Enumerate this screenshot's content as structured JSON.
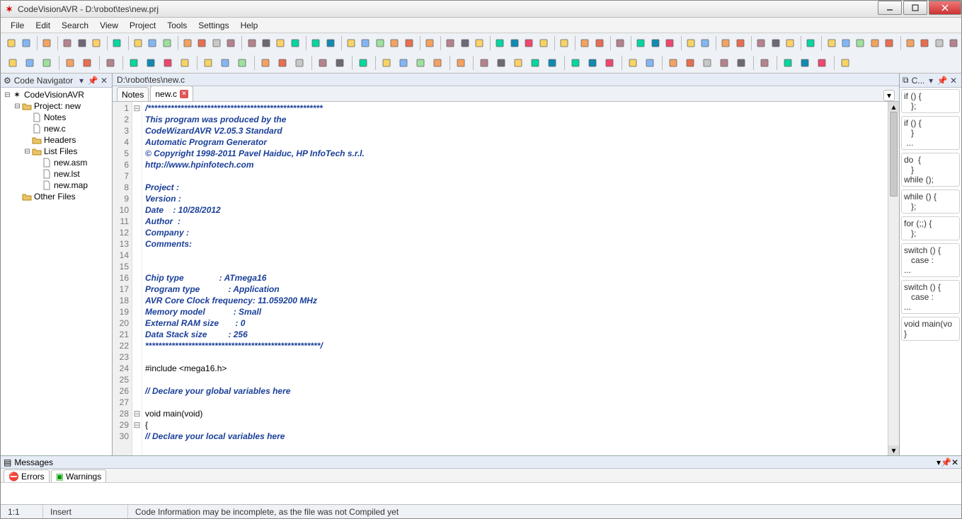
{
  "title": "CodeVisionAVR - D:\\robot\\tes\\new.prj",
  "menu": [
    "File",
    "Edit",
    "Search",
    "View",
    "Project",
    "Tools",
    "Settings",
    "Help"
  ],
  "nav": {
    "title": "Code Navigator",
    "root": "CodeVisionAVR",
    "project": "Project: new",
    "items": [
      "Notes",
      "new.c",
      "Headers"
    ],
    "listfiles": "List Files",
    "listitems": [
      "new.asm",
      "new.lst",
      "new.map"
    ],
    "other": "Other Files"
  },
  "editor": {
    "path": "D:\\robot\\tes\\new.c",
    "tabs": [
      {
        "label": "Notes",
        "active": false
      },
      {
        "label": "new.c",
        "active": true
      }
    ],
    "lines": [
      "/*****************************************************",
      "This program was produced by the",
      "CodeWizardAVR V2.05.3 Standard",
      "Automatic Program Generator",
      "© Copyright 1998-2011 Pavel Haiduc, HP InfoTech s.r.l.",
      "http://www.hpinfotech.com",
      "",
      "Project :",
      "Version :",
      "Date    : 10/28/2012",
      "Author  :",
      "Company :",
      "Comments:",
      "",
      "",
      "Chip type               : ATmega16",
      "Program type            : Application",
      "AVR Core Clock frequency: 11.059200 MHz",
      "Memory model            : Small",
      "External RAM size       : 0",
      "Data Stack size         : 256",
      "*****************************************************/",
      "",
      "#include <mega16.h>",
      "",
      "// Declare your global variables here",
      "",
      "void main(void)",
      "{",
      "// Declare your local variables here"
    ],
    "plain_lines": [
      23,
      24,
      27,
      28,
      29
    ]
  },
  "snippets_title": "C...",
  "snippets": [
    "if () {\n   };",
    "if () {\n   }\n ...",
    "do  {\n   }\nwhile ();",
    "while () {\n   };",
    "for (;;) {\n   };",
    "switch () {\n   case :\n...",
    "switch () {\n   case :\n...",
    "void main(vo\n}"
  ],
  "messages": {
    "title": "Messages",
    "tabs": [
      "Errors",
      "Warnings"
    ]
  },
  "status": {
    "pos": "1:1",
    "mode": "Insert",
    "info": "Code Information may be incomplete, as the file was not Compiled yet"
  }
}
